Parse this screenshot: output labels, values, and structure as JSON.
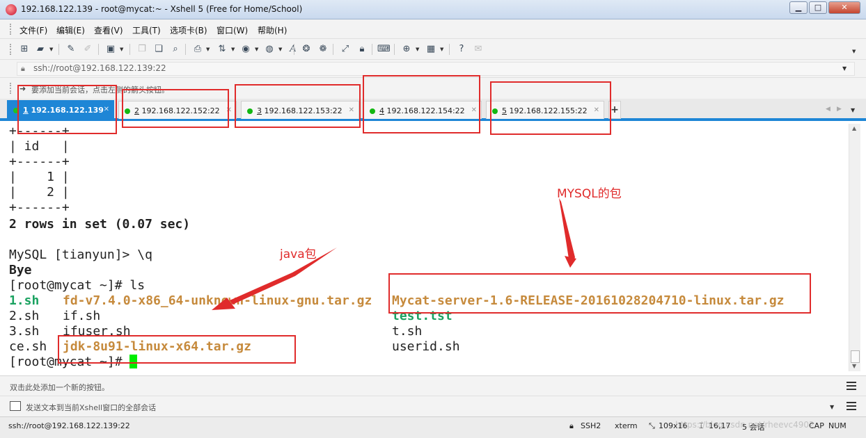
{
  "window": {
    "title": "192.168.122.139 - root@mycat:~ - Xshell 5 (Free for Home/School)",
    "controls": {
      "minimize": "▁",
      "maximize": "□",
      "close": "✕"
    }
  },
  "menu": [
    "文件(F)",
    "编辑(E)",
    "查看(V)",
    "工具(T)",
    "选项卡(B)",
    "窗口(W)",
    "帮助(H)"
  ],
  "toolbar_icons": [
    "new-session-icon",
    "open-folder-icon",
    "connect-icon",
    "disconnect-icon",
    "properties-icon",
    "copy-icon",
    "paste-icon",
    "find-icon",
    "print-icon",
    "transfer-icon",
    "color-scheme-icon",
    "globe-icon",
    "font-icon",
    "xftp-icon",
    "xmanager-icon",
    "fullscreen-icon",
    "lock-icon",
    "keyboard-icon",
    "add-icon",
    "layout-icon",
    "help-icon",
    "chat-icon"
  ],
  "address": {
    "value": "ssh://root@192.168.122.139:22"
  },
  "hint": {
    "text": "要添加当前会话，点击左侧的箭头按钮。"
  },
  "tabs": [
    {
      "num": "1",
      "label": "192.168.122.139",
      "active": true
    },
    {
      "num": "2",
      "label": "192.168.122.152:22",
      "active": false
    },
    {
      "num": "3",
      "label": "192.168.122.153:22",
      "active": false
    },
    {
      "num": "4",
      "label": "192.168.122.154:22",
      "active": false
    },
    {
      "num": "5",
      "label": "192.168.122.155:22",
      "active": false
    }
  ],
  "terminal": {
    "lines": [
      "+------+",
      "| id   |",
      "+------+",
      "|    1 |",
      "|    2 |",
      "+------+",
      "2 rows in set (0.07 sec)",
      "",
      "MySQL [tianyun]> \\q",
      "Bye",
      "[root@mycat ~]# ls"
    ],
    "ls_rows": [
      [
        "1.sh",
        "fd-v7.4.0-x86_64-unknown-linux-gnu.tar.gz",
        "Mycat-server-1.6-RELEASE-20161028204710-linux.tar.gz"
      ],
      [
        "2.sh",
        "if.sh",
        "test.tst"
      ],
      [
        "3.sh",
        "ifuser.sh",
        "t.sh"
      ],
      [
        "ce.sh",
        "jdk-8u91-linux-x64.tar.gz",
        "userid.sh"
      ]
    ],
    "prompt": "[root@mycat ~]# "
  },
  "annotations": {
    "mysql_note": "MYSQL的包",
    "java_note": "java包",
    "color": "#e02b2b"
  },
  "quickbar": {
    "text": "双击此处添加一个新的按钮。"
  },
  "compose": {
    "text": "发送文本到当前Xshell窗口的全部会话"
  },
  "status": {
    "address": "ssh://root@192.168.122.139:22",
    "protocol": "SSH2",
    "term": "xterm",
    "size": "109x16",
    "cursor": "16,17",
    "sessions": "5 会话",
    "caps": "CAP",
    "num": "NUM"
  },
  "watermark": "https://blog.csdn.net/rheevc4902",
  "colors": {
    "accent": "#1e86d6",
    "filename_orange": "#c68a3c",
    "exec_green": "#1aa260",
    "cursor": "#00ee00"
  }
}
